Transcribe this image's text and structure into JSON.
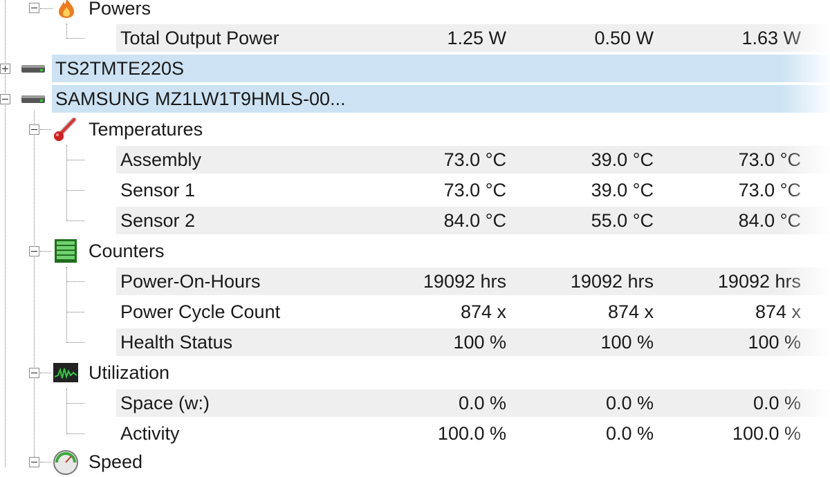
{
  "rows": {
    "powers": {
      "label": "Powers"
    },
    "total_output_power": {
      "label": "Total Output Power",
      "current": "1.25 W",
      "min": "0.50 W",
      "max": "1.63 W"
    },
    "drive_ts2": {
      "label": "TS2TMTE220S"
    },
    "drive_samsung": {
      "label": "SAMSUNG MZ1LW1T9HMLS-00..."
    },
    "temperatures": {
      "label": "Temperatures"
    },
    "assembly": {
      "label": "Assembly",
      "current": "73.0 °C",
      "min": "39.0 °C",
      "max": "73.0 °C"
    },
    "sensor1": {
      "label": "Sensor 1",
      "current": "73.0 °C",
      "min": "39.0 °C",
      "max": "73.0 °C"
    },
    "sensor2": {
      "label": "Sensor 2",
      "current": "84.0 °C",
      "min": "55.0 °C",
      "max": "84.0 °C"
    },
    "counters": {
      "label": "Counters"
    },
    "power_on_hours": {
      "label": "Power-On-Hours",
      "current": "19092 hrs",
      "min": "19092 hrs",
      "max": "19092 hrs"
    },
    "power_cycle_count": {
      "label": "Power Cycle Count",
      "current": "874 x",
      "min": "874 x",
      "max": "874 x"
    },
    "health_status": {
      "label": "Health Status",
      "current": "100 %",
      "min": "100 %",
      "max": "100 %"
    },
    "utilization": {
      "label": "Utilization"
    },
    "space": {
      "label": "Space (w:)",
      "current": "0.0 %",
      "min": "0.0 %",
      "max": "0.0 %"
    },
    "activity": {
      "label": "Activity",
      "current": "100.0 %",
      "min": "0.0 %",
      "max": "100.0 %"
    },
    "speed": {
      "label": "Speed"
    }
  },
  "icons": {
    "powers": "flame-icon",
    "drive": "drive-icon",
    "temperatures": "thermometer-icon",
    "counters": "counter-icon",
    "utilization": "activity-graph-icon",
    "speed": "gauge-icon"
  },
  "colors": {
    "device_row_bg": "#cde3f3",
    "alt_row_bg": "#efefef",
    "text": "#1a1a1a"
  }
}
